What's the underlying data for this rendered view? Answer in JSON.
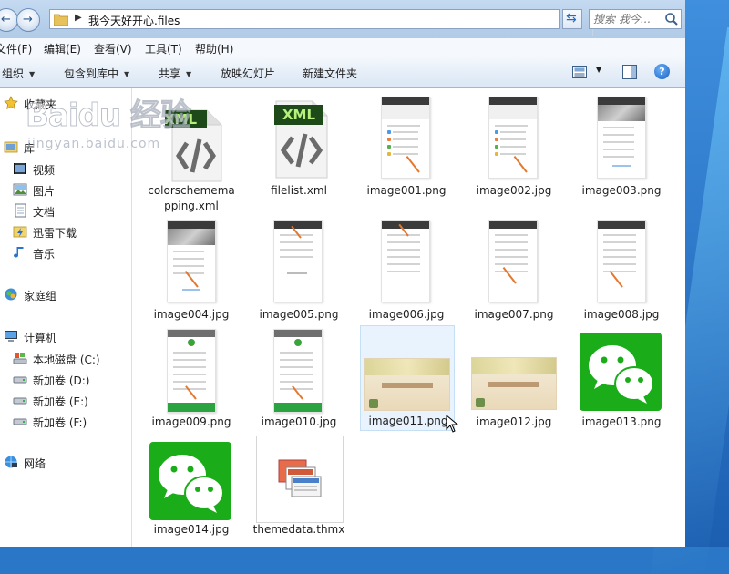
{
  "window": {
    "path_text": "我今天好开心.files",
    "search_placeholder": "搜索 我今...",
    "back_label": "←",
    "forward_label": "→",
    "refresh_label": "⇆"
  },
  "menu": [
    "文件(F)",
    "编辑(E)",
    "查看(V)",
    "工具(T)",
    "帮助(H)"
  ],
  "toolbar": {
    "organize": "组织",
    "include_in_library": "包含到库中",
    "share": "共享",
    "slideshow": "放映幻灯片",
    "new_folder": "新建文件夹",
    "help": "?"
  },
  "sidebar": {
    "favorites": "收藏夹",
    "libraries": "库",
    "video": "视频",
    "pictures": "图片",
    "documents": "文档",
    "thunder": "迅雷下载",
    "music": "音乐",
    "homegroup": "家庭组",
    "computer": "计算机",
    "drive_c": "本地磁盘 (C:)",
    "drive_d": "新加卷 (D:)",
    "drive_e": "新加卷 (E:)",
    "drive_f": "新加卷 (F:)",
    "network": "网络"
  },
  "files": {
    "f1_line1": "colorschemema",
    "f1_line2": "pping.xml",
    "f2": "filelist.xml",
    "f3": "image001.png",
    "f4": "image002.jpg",
    "f5": "image003.png",
    "f6": "image004.jpg",
    "f7": "image005.png",
    "f8": "image006.jpg",
    "f9": "image007.png",
    "f10": "image008.jpg",
    "f11": "image009.png",
    "f12": "image010.jpg",
    "f13": "image011.png",
    "f14": "image012.jpg",
    "f15": "image013.png",
    "f16": "image014.jpg",
    "f17": "themedata.thmx",
    "xml_badge": "XML"
  },
  "watermark": {
    "brand": "Baidu 经验",
    "url": "jingyan.baidu.com"
  },
  "colors": {
    "wechat_green": "#1aad19",
    "xml_badge_bg": "#1e4a1a",
    "xml_badge_text": "#b7f07a",
    "selection_bg": "#e8f3fd"
  }
}
